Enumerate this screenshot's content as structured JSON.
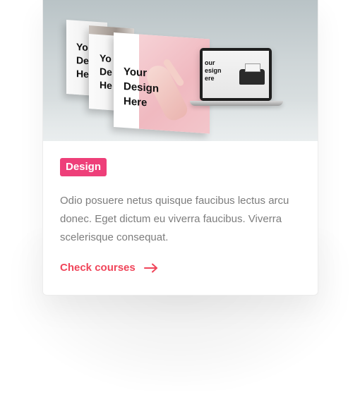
{
  "card": {
    "image": {
      "alt_icon": "design-mockup-image",
      "panel_texts": [
        "Yo\nDe\nHe",
        "Yo\nDe\nHe",
        "Your\nDesign\nHere"
      ],
      "laptop_text": "our\nesign\nere"
    },
    "tag": {
      "label": "Design",
      "color": "#ee3f79"
    },
    "description": "Odio posuere netus quisque faucibus lectus arcu donec. Eget dictum eu viverra faucibus. Viverra scelerisque consequat.",
    "cta": {
      "label": "Check courses",
      "icon": "arrow-right-icon",
      "color": "#f0455a"
    }
  }
}
